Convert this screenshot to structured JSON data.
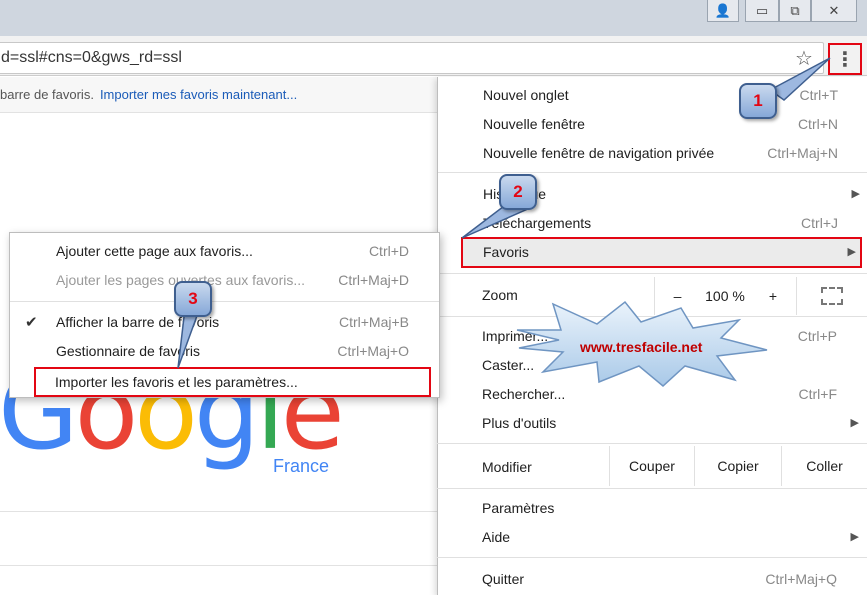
{
  "window": {
    "buttons": [
      "user-icon",
      "minimize-icon",
      "restore-icon",
      "close-icon"
    ]
  },
  "omnibox": {
    "url": "d=ssl#cns=0&gws_rd=ssl"
  },
  "bookmark_bar": {
    "text": "barre de favoris.",
    "link": "Importer mes favoris maintenant..."
  },
  "google": {
    "logo_letters": [
      "G",
      "o",
      "o",
      "g",
      "l",
      "e"
    ],
    "logo_colors": [
      "#4285f4",
      "#ea4335",
      "#fbbc05",
      "#4285f4",
      "#34a853",
      "#ea4335"
    ],
    "country": "France"
  },
  "menu": {
    "items": [
      {
        "label": "Nouvel onglet",
        "shortcut": "Ctrl+T"
      },
      {
        "label": "Nouvelle fenêtre",
        "shortcut": "Ctrl+N"
      },
      {
        "label": "Nouvelle fenêtre de navigation privée",
        "shortcut": "Ctrl+Maj+N"
      },
      {
        "label": "Historique",
        "shortcut": ""
      },
      {
        "label": "Téléchargements",
        "shortcut": "Ctrl+J"
      },
      {
        "label": "Favoris",
        "shortcut": ""
      },
      {
        "label": "Imprimer...",
        "shortcut": "Ctrl+P"
      },
      {
        "label": "Caster...",
        "shortcut": ""
      },
      {
        "label": "Rechercher...",
        "shortcut": "Ctrl+F"
      },
      {
        "label": "Plus d'outils",
        "shortcut": ""
      },
      {
        "label": "Paramètres",
        "shortcut": ""
      },
      {
        "label": "Aide",
        "shortcut": ""
      },
      {
        "label": "Quitter",
        "shortcut": "Ctrl+Maj+Q"
      }
    ],
    "zoom": {
      "label": "Zoom",
      "minus": "–",
      "value": "100 %",
      "plus": "+"
    },
    "edit": {
      "label": "Modifier",
      "cut": "Couper",
      "copy": "Copier",
      "paste": "Coller"
    }
  },
  "submenu": {
    "items": [
      {
        "label": "Ajouter cette page aux favoris...",
        "shortcut": "Ctrl+D"
      },
      {
        "label": "Ajouter les pages ouvertes aux favoris...",
        "shortcut": "Ctrl+Maj+D"
      },
      {
        "label": "Afficher la barre de favoris",
        "shortcut": "Ctrl+Maj+B"
      },
      {
        "label": "Gestionnaire de favoris",
        "shortcut": "Ctrl+Maj+O"
      },
      {
        "label": "Importer les favoris et les paramètres...",
        "shortcut": ""
      }
    ]
  },
  "callouts": [
    "1",
    "2",
    "3"
  ],
  "watermark": "www.tresfacile.net",
  "colors": {
    "highlight": "#e30613",
    "callout_fill": "#9db8e0",
    "callout_border": "#3f5f8f"
  }
}
